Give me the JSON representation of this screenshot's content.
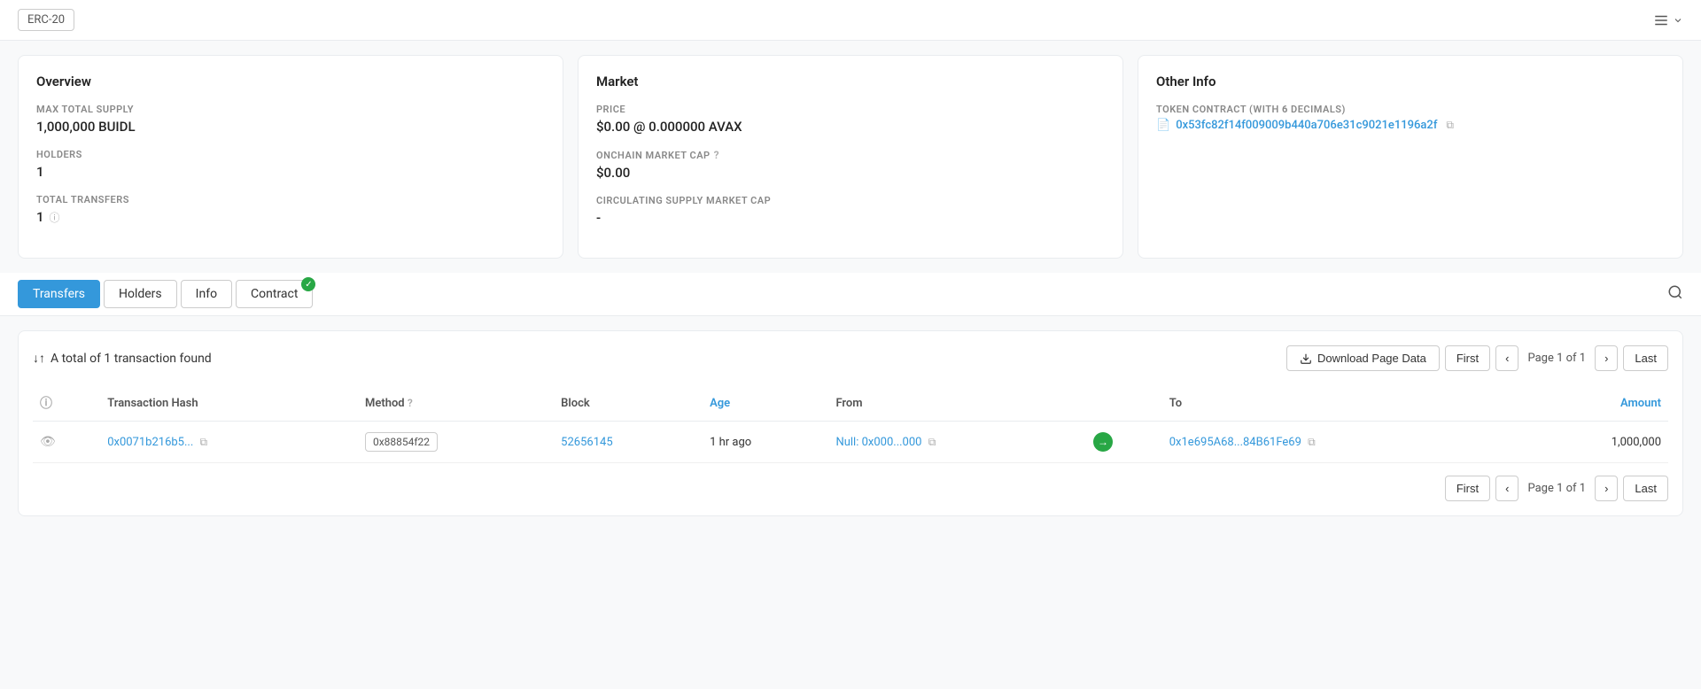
{
  "topbar": {
    "erc_label": "ERC-20",
    "list_icon": "☰"
  },
  "cards": {
    "overview": {
      "title": "Overview",
      "max_supply_label": "MAX TOTAL SUPPLY",
      "max_supply_value": "1,000,000 BUIDL",
      "holders_label": "HOLDERS",
      "holders_value": "1",
      "total_transfers_label": "TOTAL TRANSFERS",
      "total_transfers_value": "1"
    },
    "market": {
      "title": "Market",
      "price_label": "PRICE",
      "price_value": "$0.00 @ 0.000000 AVAX",
      "onchain_cap_label": "ONCHAIN MARKET CAP",
      "onchain_cap_value": "$0.00",
      "circulating_label": "CIRCULATING SUPPLY MARKET CAP",
      "circulating_value": "-"
    },
    "other_info": {
      "title": "Other Info",
      "token_contract_label": "TOKEN CONTRACT (WITH 6 DECIMALS)",
      "token_contract_link": "0x53fc82f14f009009b440a706e31c9021e1196a2f"
    }
  },
  "tabs": {
    "transfers_label": "Transfers",
    "holders_label": "Holders",
    "info_label": "Info",
    "contract_label": "Contract",
    "contract_verified": true
  },
  "table": {
    "summary_icon": "↓↑",
    "summary_text": "A total of 1 transaction found",
    "download_label": "Download Page Data",
    "first_label": "First",
    "last_label": "Last",
    "page_label": "Page 1 of 1",
    "columns": {
      "hash_label": "Transaction Hash",
      "method_label": "Method",
      "block_label": "Block",
      "age_label": "Age",
      "from_label": "From",
      "to_label": "To",
      "amount_label": "Amount"
    },
    "rows": [
      {
        "hash": "0x0071b216b5...",
        "method": "0x88854f22",
        "block": "52656145",
        "age": "1 hr ago",
        "from": "Null: 0x000...000",
        "to": "0x1e695A68...84B61Fe69",
        "amount": "1,000,000"
      }
    ]
  },
  "bottom_pagination": {
    "first_label": "First",
    "last_label": "Last",
    "page_label": "Page 1 of 1"
  }
}
